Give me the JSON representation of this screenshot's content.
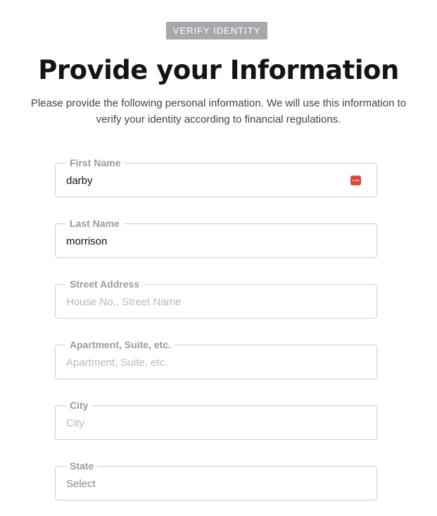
{
  "badge": "VERIFY IDENTITY",
  "title": "Provide your Information",
  "intro": "Please provide the following personal information. We will use this information to verify your identity according to financial regulations.",
  "fields": [
    {
      "label": "First Name",
      "value": "darby",
      "placeholder": "",
      "icon": "password-manager-icon"
    },
    {
      "label": "Last Name",
      "value": "morrison",
      "placeholder": ""
    },
    {
      "label": "Street Address",
      "value": "",
      "placeholder": "House No., Street Name"
    },
    {
      "label": "Apartment, Suite, etc.",
      "value": "",
      "placeholder": "Apartment, Suite, etc."
    },
    {
      "label": "City",
      "value": "",
      "placeholder": "City"
    },
    {
      "label": "State",
      "selected": "Select"
    }
  ]
}
